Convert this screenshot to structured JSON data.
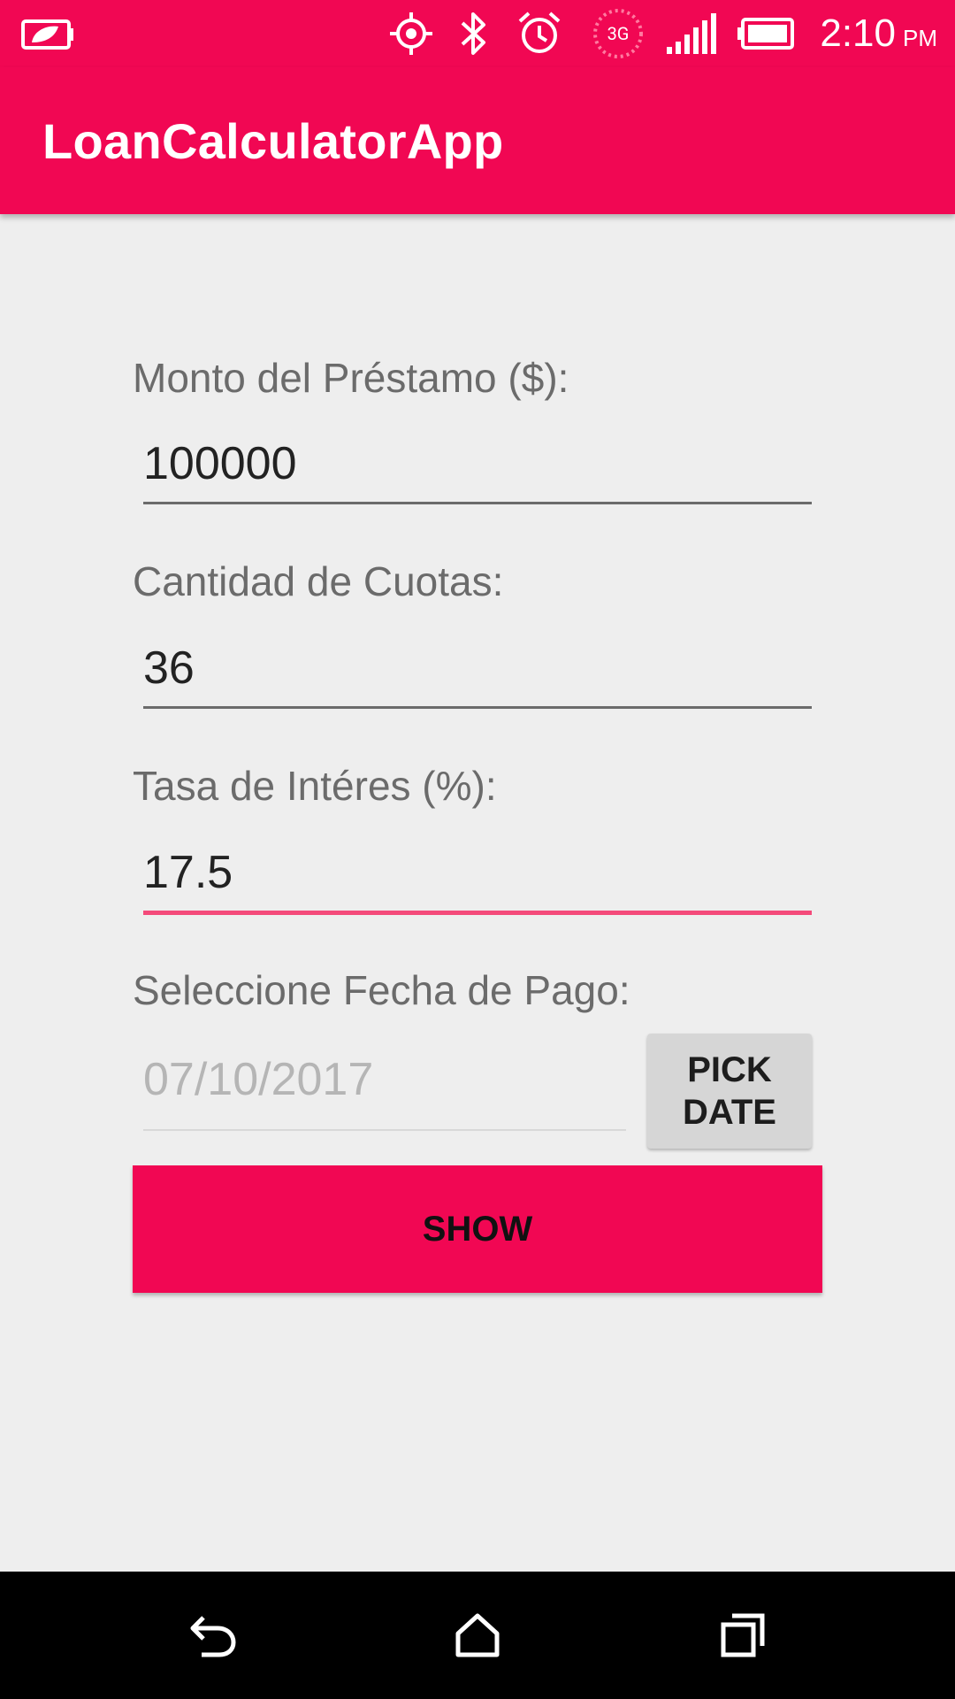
{
  "status_bar": {
    "time": "2:10",
    "ampm": "PM",
    "network": "3G",
    "icons": [
      "battery-saver-icon",
      "gps-icon",
      "bluetooth-icon",
      "alarm-icon",
      "3g-icon",
      "signal-icon",
      "battery-icon"
    ]
  },
  "app_bar": {
    "title": "LoanCalculatorApp"
  },
  "form": {
    "amount_label": "Monto del Préstamo ($):",
    "amount_value": "100000",
    "installments_label": "Cantidad de Cuotas:",
    "installments_value": "36",
    "rate_label": "Tasa de Intéres (%):",
    "rate_value": "17.5",
    "date_label": "Seleccione Fecha de Pago:",
    "date_value": "07/10/2017",
    "pick_date_line1": "PICK",
    "pick_date_line2": "DATE",
    "show_label": "SHOW"
  },
  "colors": {
    "primary": "#f10753",
    "accent": "#f44a7a",
    "background": "#eeeeee"
  },
  "nav_bar": {
    "icons": [
      "back-icon",
      "home-icon",
      "recents-icon"
    ]
  }
}
